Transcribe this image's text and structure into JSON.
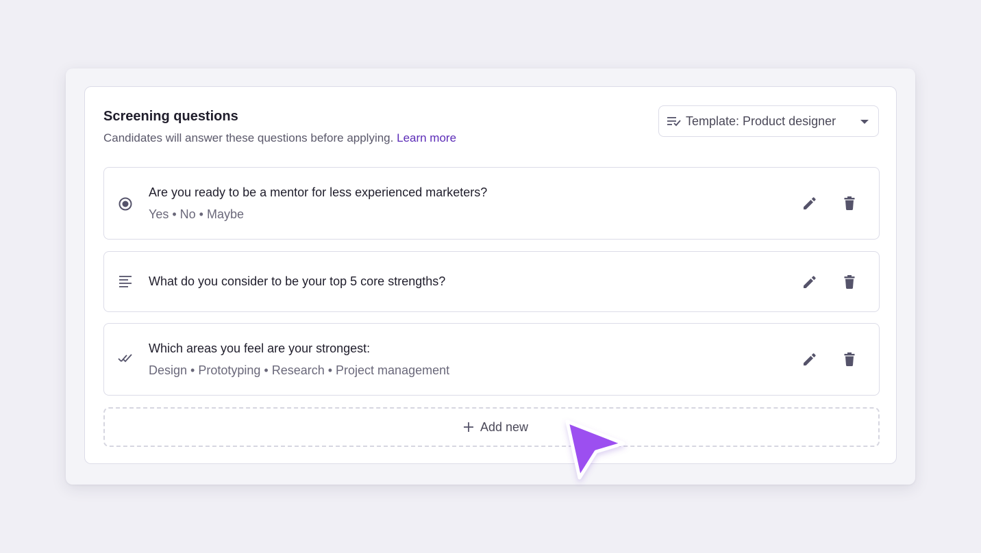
{
  "screening": {
    "title": "Screening questions",
    "subtitle": "Candidates will answer these questions before applying.",
    "learn_more": "Learn more",
    "template_label": "Template: Product designer"
  },
  "questions": [
    {
      "icon": "radio-icon",
      "text": "Are you ready to be a mentor for less experienced marketers?",
      "options": "Yes • No • Maybe"
    },
    {
      "icon": "paragraph-icon",
      "text": "What do you consider to be your top 5 core strengths?",
      "options": ""
    },
    {
      "icon": "double-check-icon",
      "text": "Which areas you feel are your strongest:",
      "options": "Design • Prototyping • Research • Project management"
    }
  ],
  "add_new_label": "Add new",
  "colors": {
    "accent": "#5b2bb7",
    "cursor": "#9c4ff0",
    "icon": "#55536a",
    "background": "#f0eff5"
  }
}
